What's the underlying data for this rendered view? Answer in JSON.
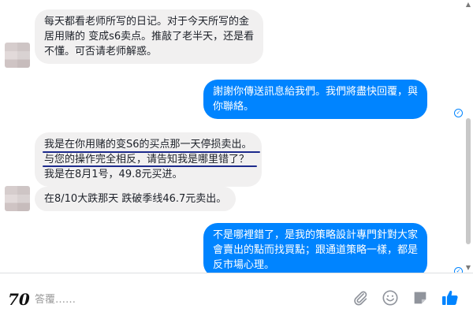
{
  "messages": [
    {
      "id": "m1",
      "side": "incoming",
      "lines": [
        "每天都看老师所写的日记。对于今天所写的金",
        "居用赌的 变成s6卖点。推敲了老半天，还是看",
        "不懂。可否请老师解惑。"
      ]
    },
    {
      "id": "m2",
      "side": "outgoing",
      "lines": [
        "謝謝你傳送訊息給我們。我們將盡快回覆，與",
        "你聯絡。"
      ]
    },
    {
      "id": "m3",
      "side": "incoming",
      "lines": [
        "我是在你用赌的变S6的买点那一天停损卖出。",
        "与您的操作完全相反，请告知我是哪里错了？",
        "我是在8月1号，49.8元买进。"
      ]
    },
    {
      "id": "m4",
      "side": "incoming",
      "lines": [
        "在8/10大跌那天 跌破季线46.7元卖出。"
      ]
    },
    {
      "id": "m5",
      "side": "outgoing",
      "lines": [
        "不是哪裡錯了，是我的策略設計專門針對大家",
        "會賣出的點而找買點；跟通道策略一樣，都是",
        "反市場心理。"
      ]
    }
  ],
  "composer": {
    "placeholder": "答覆……",
    "logo_text": "70"
  },
  "icons": {
    "attach": "paperclip-icon",
    "emoji": "emoji-icon",
    "sticker": "sticker-icon",
    "like": "thumbs-up-icon",
    "seen": "seen-check-icon"
  },
  "colors": {
    "outgoing_bubble": "#0084ff",
    "incoming_bubble": "#f1f0f0",
    "like_icon": "#0084ff",
    "underline": "#1c2a8c"
  }
}
